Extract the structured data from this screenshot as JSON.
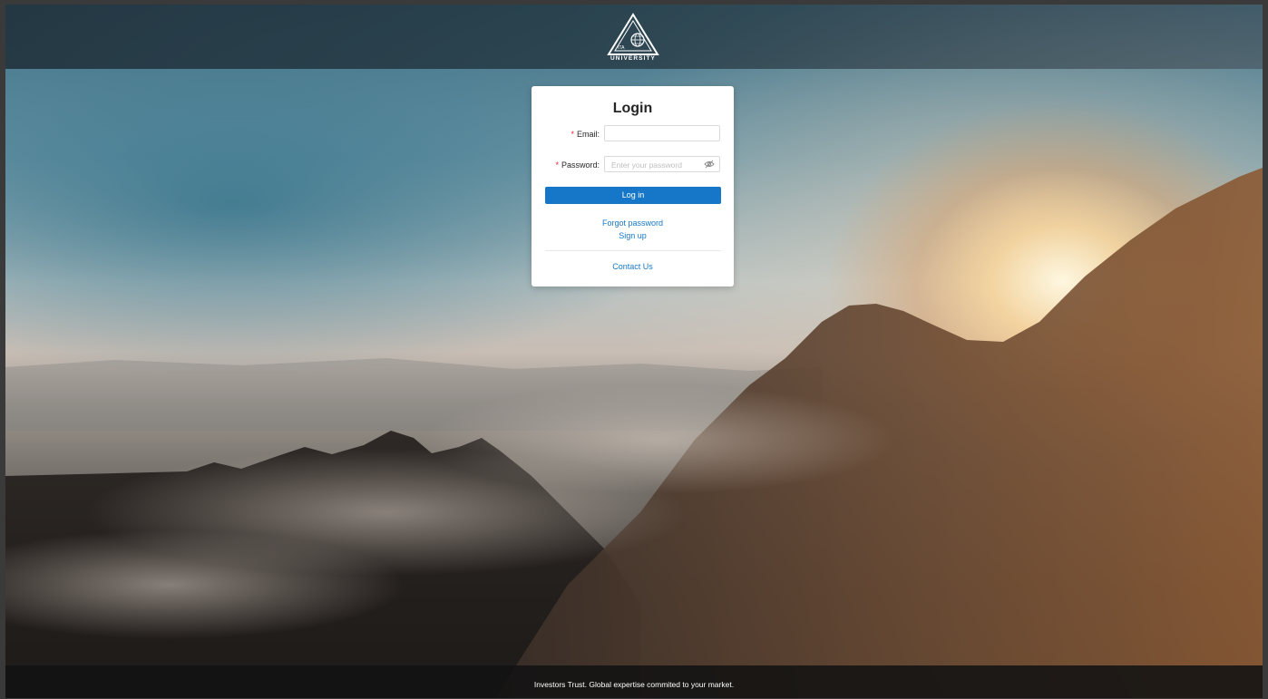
{
  "header": {
    "logo_small_text": "ITA",
    "logo_text": "UNIVERSITY"
  },
  "login_form": {
    "title": "Login",
    "email": {
      "required_mark": "*",
      "label": "Email",
      "separator": ":",
      "value": "",
      "placeholder": ""
    },
    "password": {
      "required_mark": "*",
      "label": "Password",
      "separator": ":",
      "value": "",
      "placeholder": "Enter your password",
      "visibility_icon": "eye-invisible-icon"
    },
    "login_button_label": "Log in",
    "forgot_password_label": "Forgot password",
    "sign_up_label": "Sign up",
    "contact_label": "Contact Us"
  },
  "footer": {
    "text": "Investors Trust. Global expertise commited to your market."
  },
  "colors": {
    "primary": "#1677c8",
    "required": "#f5222d",
    "text": "#262626",
    "footer_bg": "#121212"
  }
}
